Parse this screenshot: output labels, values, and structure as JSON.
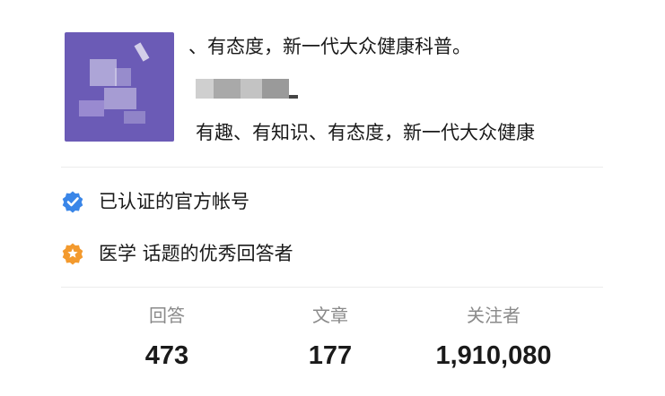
{
  "profile": {
    "headline": "、有态度，新一代大众健康科普。",
    "bio": "有趣、有知识、有态度，新一代大众健康",
    "avatar_icon": "blurred-avatar",
    "avatar_color": "#6b5bb6"
  },
  "badges": [
    {
      "icon": "verified-check-icon",
      "color": "#3a86e8",
      "label": "已认证的官方帐号"
    },
    {
      "icon": "star-badge-icon",
      "color": "#f39a2e",
      "label": "医学 话题的优秀回答者"
    }
  ],
  "stats": [
    {
      "label": "回答",
      "value": "473"
    },
    {
      "label": "文章",
      "value": "177"
    },
    {
      "label": "关注者",
      "value": "1,910,080"
    }
  ]
}
